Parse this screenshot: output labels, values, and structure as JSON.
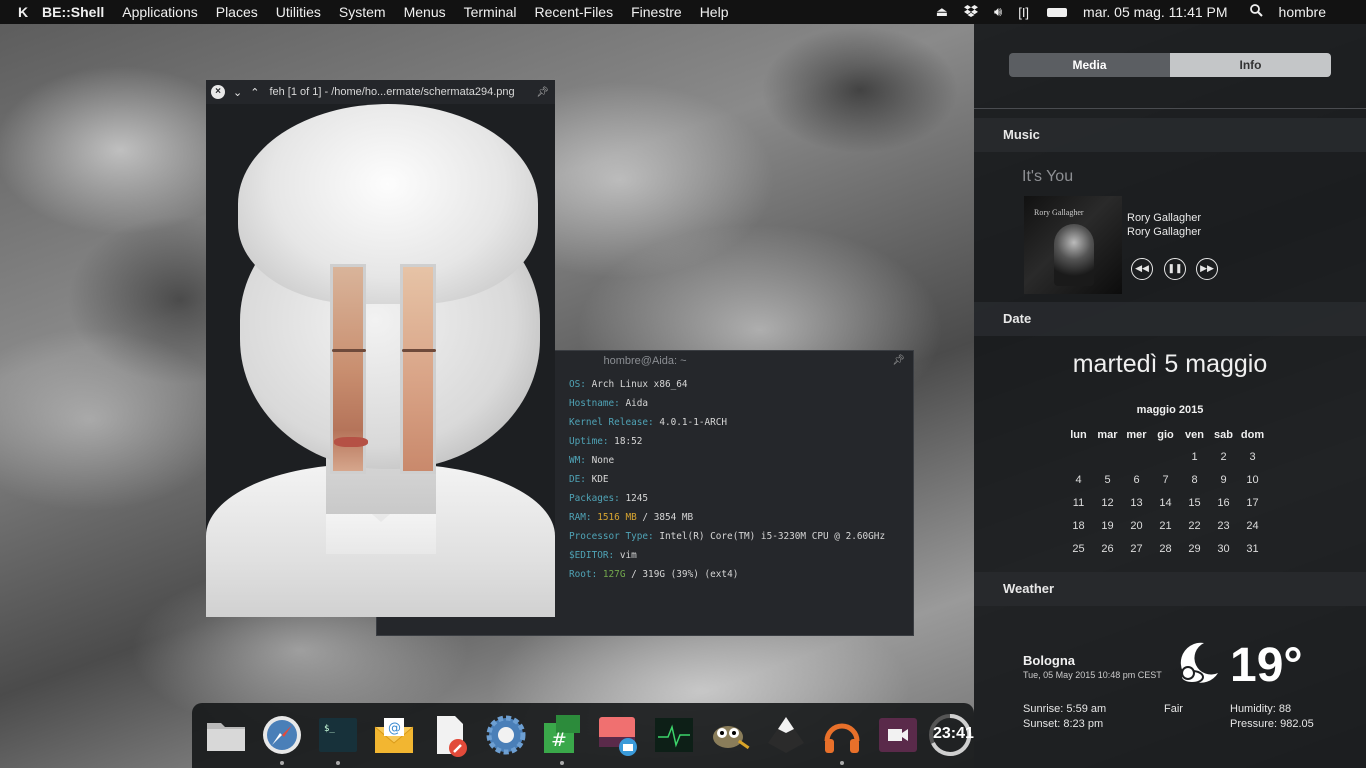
{
  "topbar": {
    "logo": "K",
    "menus": [
      "BE::Shell",
      "Applications",
      "Places",
      "Utilities",
      "System",
      "Menus",
      "Terminal",
      "Recent-Files",
      "Finestre",
      "Help"
    ],
    "clock": "mar. 05 mag. 11:41 PM",
    "user": "hombre"
  },
  "panel": {
    "tabs": [
      "Media",
      "Info"
    ],
    "music": {
      "section": "Music",
      "track": "It's You",
      "artist": "Rory Gallagher",
      "album": "Rory Gallagher",
      "cover_text": "Rory Gallagher"
    },
    "date": {
      "section": "Date",
      "big": "martedì 5 maggio",
      "month": "maggio 2015",
      "weekdays": [
        "lun",
        "mar",
        "mer",
        "gio",
        "ven",
        "sab",
        "dom"
      ],
      "weeks": [
        [
          "",
          "",
          "",
          "",
          "1",
          "2",
          "3"
        ],
        [
          "4",
          "5",
          "6",
          "7",
          "8",
          "9",
          "10"
        ],
        [
          "11",
          "12",
          "13",
          "14",
          "15",
          "16",
          "17"
        ],
        [
          "18",
          "19",
          "20",
          "21",
          "22",
          "23",
          "24"
        ],
        [
          "25",
          "26",
          "27",
          "28",
          "29",
          "30",
          "31"
        ]
      ]
    },
    "weather": {
      "section": "Weather",
      "city": "Bologna",
      "updated": "Tue, 05 May 2015 10:48 pm CEST",
      "temp": "19°",
      "sunrise": "Sunrise: 5:59 am",
      "sunset": "Sunset: 8:23 pm",
      "condition": "Fair",
      "humidity": "Humidity: 88",
      "pressure": "Pressure: 982.05"
    }
  },
  "terminal": {
    "title": "hombre@Aida: ~",
    "lines": [
      {
        "k": "OS:",
        "v": "Arch Linux x86_64"
      },
      {
        "k": "Hostname:",
        "v": "Aida"
      },
      {
        "k": "Kernel Release:",
        "v": "4.0.1-1-ARCH"
      },
      {
        "k": "Uptime:",
        "v": "18:52"
      },
      {
        "k": "WM:",
        "v": "None"
      },
      {
        "k": "DE:",
        "v": "KDE"
      },
      {
        "k": "Packages:",
        "v": "1245"
      },
      {
        "k": "RAM:",
        "v": "1516 MB",
        "v2": "/ 3854 MB",
        "color": "y"
      },
      {
        "k": "Processor Type:",
        "v": "Intel(R) Core(TM) i5-3230M CPU @ 2.60GHz"
      },
      {
        "k": "$EDITOR:",
        "v": "vim"
      },
      {
        "k": "Root:",
        "v": "127G",
        "v2": "/ 319G (39%) (ext4)",
        "color": "g"
      }
    ]
  },
  "feh": {
    "title": "feh [1 of 1] - /home/ho...ermate/schermata294.png"
  },
  "dock": {
    "clock": "23:41",
    "items": [
      "folder-icon",
      "safari-icon",
      "terminal-icon",
      "mail-icon",
      "text-editor-icon",
      "settings-gear-icon",
      "hashtag-chat-icon",
      "screenshot-icon",
      "system-monitor-icon",
      "gimp-icon",
      "inkscape-icon",
      "headphones-icon",
      "video-camera-icon",
      "clock-icon"
    ],
    "colors": {
      "accent": "#e8702a",
      "purple": "#5a2a4a",
      "green": "#3aa84a",
      "blue": "#4a7fb8"
    }
  }
}
